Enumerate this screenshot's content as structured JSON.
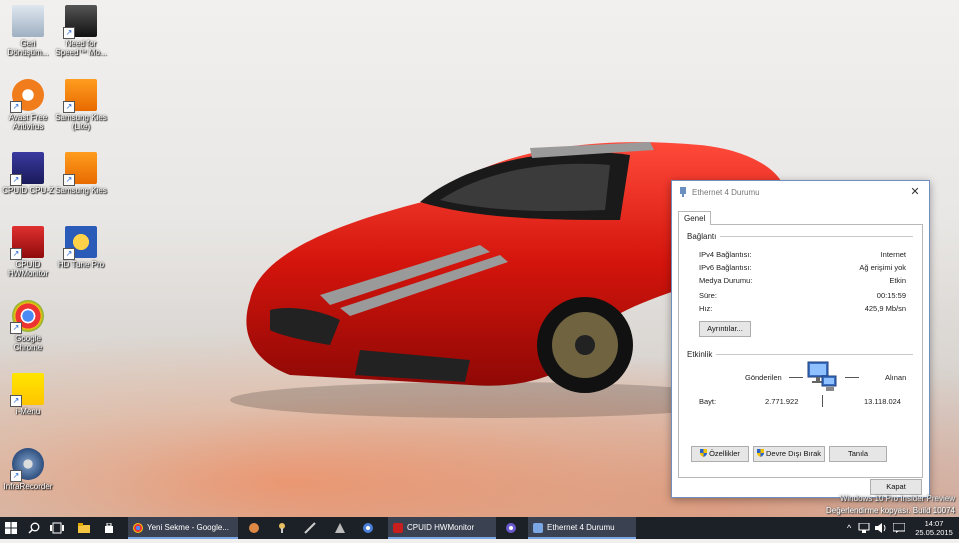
{
  "desktop": {
    "icons": [
      {
        "label": "Geri Dönüşüm...",
        "icon": "recycle-bin-icon"
      },
      {
        "label": "Need for Speed™ Mo...",
        "icon": "nfs-icon"
      },
      {
        "label": "Avast Free Antivirus",
        "icon": "avast-icon"
      },
      {
        "label": "Samsung Kies (Lite)",
        "icon": "kies-lite-icon"
      },
      {
        "label": "CPUID CPU-Z",
        "icon": "cpuz-icon"
      },
      {
        "label": "Samsung Kies",
        "icon": "kies-icon"
      },
      {
        "label": "CPUID HWMonitor",
        "icon": "hwmonitor-icon"
      },
      {
        "label": "HD Tune Pro",
        "icon": "hdtune-icon"
      },
      {
        "label": "Google Chrome",
        "icon": "chrome-icon"
      },
      {
        "label": "i-Menu",
        "icon": "imenu-icon"
      },
      {
        "label": "InfraRecorder",
        "icon": "infrarecorder-icon"
      }
    ]
  },
  "dialog": {
    "title": "Ethernet 4 Durumu",
    "tab": "Genel",
    "connection": {
      "label": "Bağlantı",
      "rows": [
        {
          "key": "IPv4 Bağlantısı:",
          "value": "Internet"
        },
        {
          "key": "IPv6 Bağlantısı:",
          "value": "Ağ erişimi yok"
        },
        {
          "key": "Medya Durumu:",
          "value": "Etkin"
        },
        {
          "key": "Süre:",
          "value": "00:15:59"
        },
        {
          "key": "Hız:",
          "value": "425,9 Mb/sn"
        }
      ],
      "details_button": "Ayrıntılar..."
    },
    "activity": {
      "label": "Etkinlik",
      "sent_label": "Gönderilen",
      "received_label": "Alınan",
      "bytes_label": "Bayt:",
      "bytes_sent": "2.771.922",
      "bytes_received": "13.118.024"
    },
    "buttons": {
      "properties": "Özellikler",
      "disable": "Devre Dışı Bırak",
      "diagnose": "Tanıla",
      "close": "Kapat"
    }
  },
  "taskbar": {
    "apps": [
      {
        "label": "Yeni Sekme - Google...",
        "icon": "chrome-icon"
      },
      {
        "label": "CPUID HWMonitor",
        "icon": "hwmonitor-icon"
      },
      {
        "label": "Ethernet 4 Durumu",
        "icon": "network-icon"
      }
    ],
    "watermark_line1": "Windows 10 Pro Insider Preview",
    "watermark_line2": "Değerlendirme kopyası. Build 10074",
    "time": "14:07",
    "date": "25.05.2015"
  },
  "colors": {
    "taskbar": "#1c2027",
    "accent": "#7aa7e3",
    "car_red": "#d3140c"
  }
}
